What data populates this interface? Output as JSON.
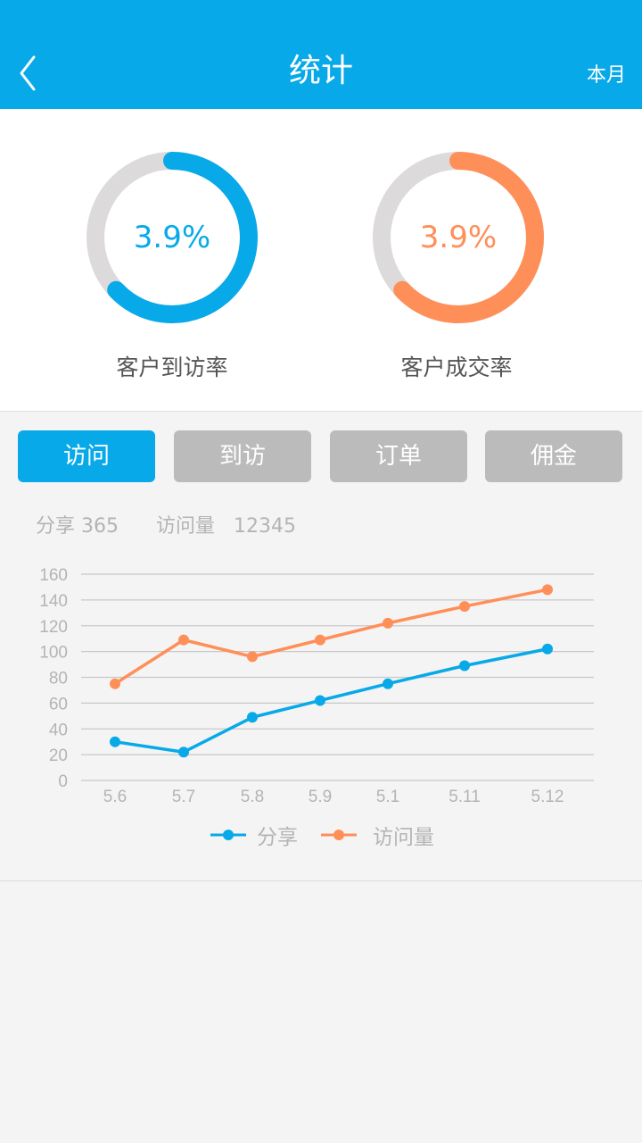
{
  "header": {
    "title": "统计",
    "back_icon": "chevron-left-icon",
    "period_label": "本月",
    "background": "#08a9e9"
  },
  "rates": [
    {
      "label": "客户到访率",
      "value_text": "3.9%",
      "fill_fraction": 0.63,
      "color": "#08a9e9",
      "track_color": "#dcdada"
    },
    {
      "label": "客户成交率",
      "value_text": "3.9%",
      "fill_fraction": 0.63,
      "color": "#ff8f59",
      "track_color": "#dcdada"
    }
  ],
  "tabs": [
    {
      "label": "访问",
      "active": true
    },
    {
      "label": "到访",
      "active": false
    },
    {
      "label": "订单",
      "active": false
    },
    {
      "label": "佣金",
      "active": false
    }
  ],
  "summary": {
    "share_label": "分享",
    "share_value": "365",
    "visits_label": "访问量",
    "visits_value": "12345"
  },
  "chart_data": {
    "type": "line",
    "title": "",
    "xlabel": "",
    "ylabel": "",
    "categories": [
      "5.6",
      "5.7",
      "5.8",
      "5.9",
      "5.1",
      "5.11",
      "5.12"
    ],
    "yticks": [
      0,
      20,
      40,
      60,
      80,
      100,
      120,
      140,
      160
    ],
    "ylim": [
      0,
      160
    ],
    "grid": true,
    "legend_position": "bottom-center",
    "series": [
      {
        "name": "分享",
        "color": "#08a9e9",
        "values": [
          30,
          22,
          49,
          62,
          75,
          89,
          102
        ]
      },
      {
        "name": "访问量",
        "color": "#ff8f59",
        "values": [
          75,
          109,
          96,
          109,
          122,
          135,
          148
        ]
      }
    ]
  }
}
